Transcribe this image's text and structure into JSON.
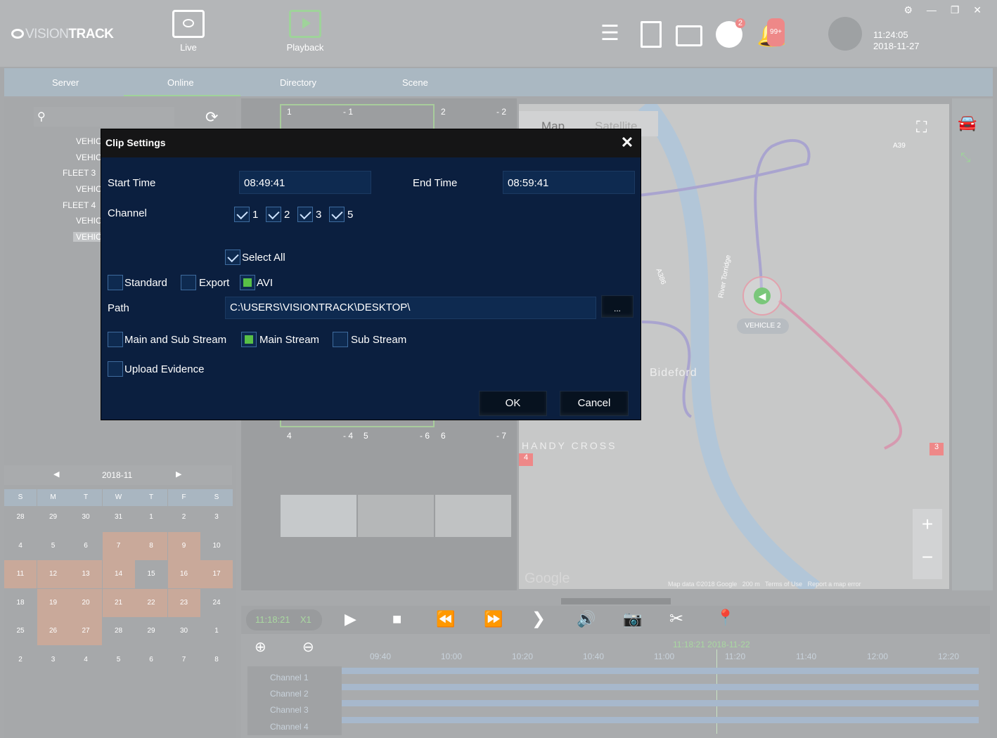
{
  "app": {
    "logo_text_a": "VISION",
    "logo_text_b": "TRACK",
    "nav": {
      "live": "Live",
      "playback": "Playback"
    },
    "badges": {
      "download": "2",
      "alerts": "99+"
    },
    "clock": {
      "time": "11:24:05",
      "date": "2018-11-27"
    },
    "window_controls": "⚙ — ❐ ✕"
  },
  "tabs": [
    "Server",
    "Online",
    "Directory",
    "Scene"
  ],
  "tree": {
    "items": [
      "VEHIC",
      "VEHIC",
      "FLEET 3",
      "VEHIC",
      "FLEET 4",
      "VEHIC",
      "VEHIC"
    ]
  },
  "calendar": {
    "month": "2018-11",
    "weekdays": [
      "S",
      "M",
      "T",
      "W",
      "T",
      "F",
      "S"
    ],
    "days": [
      "28",
      "29",
      "30",
      "31",
      "1",
      "2",
      "3",
      "4",
      "5",
      "6",
      "7",
      "8",
      "9",
      "10",
      "11",
      "12",
      "13",
      "14",
      "15",
      "16",
      "17",
      "18",
      "19",
      "20",
      "21",
      "22",
      "23",
      "24",
      "25",
      "26",
      "27",
      "28",
      "29",
      "30",
      "1",
      "2",
      "3",
      "4",
      "5",
      "6",
      "7",
      "8"
    ]
  },
  "video": {
    "tile_labels": [
      "1",
      "- 1",
      "2",
      "- 2",
      "4",
      "- 4",
      "5",
      "- 6",
      "6",
      "- 7"
    ]
  },
  "map": {
    "tab_map": "Map",
    "tab_satellite": "Satellite",
    "vehicle_label": "VEHICLE 2",
    "place_bideford": "Bideford",
    "place_handy_cross": "HANDY CROSS",
    "road_a39": "A39",
    "road_a386": "A386",
    "river": "River Torridge",
    "google": "Google",
    "footer": "Map data ©2018 Google   200 m   Terms of Use   Report a map error",
    "markers": [
      "3",
      "4"
    ]
  },
  "playback": {
    "time_display": "11:18:21",
    "speed": "X1",
    "cursor_label": "11:18:21 2018-11-22",
    "ticks": [
      "09:40",
      "10:00",
      "10:20",
      "10:40",
      "11:00",
      "11:20",
      "11:40",
      "12:00",
      "12:20"
    ],
    "channels": [
      "Channel 1",
      "Channel 2",
      "Channel 3",
      "Channel 4"
    ]
  },
  "dialog": {
    "title": "Clip Settings",
    "close": "✕",
    "start_time_label": "Start Time",
    "start_time_value": "08:49:41",
    "end_time_label": "End Time",
    "end_time_value": "08:59:41",
    "channel_label": "Channel",
    "channels": [
      "1",
      "2",
      "3",
      "5"
    ],
    "select_all_label": "Select All",
    "format_options": {
      "standard": "Standard",
      "export": "Export",
      "avi": "AVI"
    },
    "path_label": "Path",
    "path_value": "C:\\USERS\\VISIONTRACK\\DESKTOP\\",
    "browse_label": "...",
    "stream_options": {
      "main_and_sub": "Main and Sub Stream",
      "main": "Main Stream",
      "sub": "Sub Stream"
    },
    "upload_evidence_label": "Upload Evidence",
    "ok_label": "OK",
    "cancel_label": "Cancel"
  }
}
